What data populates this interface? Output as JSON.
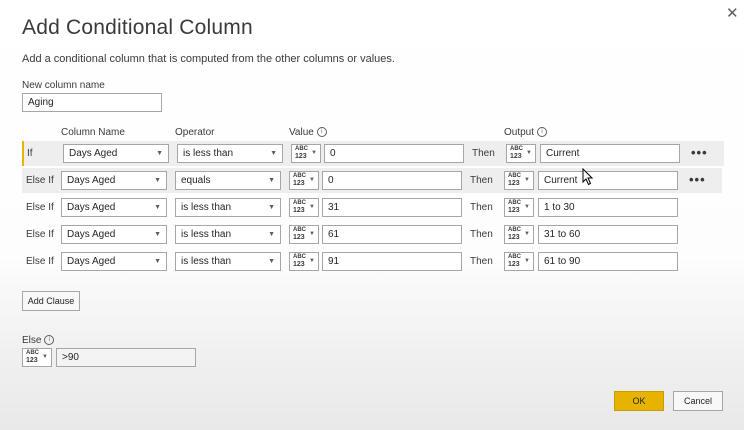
{
  "dialog": {
    "title": "Add Conditional Column",
    "description": "Add a conditional column that is computed from the other columns or values.",
    "close_glyph": "✕"
  },
  "new_column": {
    "label": "New column name",
    "value": "Aging"
  },
  "headers": {
    "column_name": "Column Name",
    "operator": "Operator",
    "value": "Value",
    "output": "Output"
  },
  "type_icon": {
    "top": "ABC",
    "bottom": "123",
    "name": "any-type-icon"
  },
  "clauses": [
    {
      "keyword": "If",
      "column": "Days Aged",
      "operator": "is less than",
      "value": "0",
      "then": "Then",
      "output": "Current",
      "more": "•••"
    },
    {
      "keyword": "Else If",
      "column": "Days Aged",
      "operator": "equals",
      "value": "0",
      "then": "Then",
      "output": "Current",
      "more": "•••"
    },
    {
      "keyword": "Else If",
      "column": "Days Aged",
      "operator": "is less than",
      "value": "31",
      "then": "Then",
      "output": "1 to 30"
    },
    {
      "keyword": "Else If",
      "column": "Days Aged",
      "operator": "is less than",
      "value": "61",
      "then": "Then",
      "output": "31 to 60"
    },
    {
      "keyword": "Else If",
      "column": "Days Aged",
      "operator": "is less than",
      "value": "91",
      "then": "Then",
      "output": "61 to 90"
    }
  ],
  "add_clause_label": "Add Clause",
  "else": {
    "label": "Else",
    "value": ">90"
  },
  "buttons": {
    "ok": "OK",
    "cancel": "Cancel"
  },
  "colors": {
    "accent": "#e6b400",
    "row_highlight": "#eeeeee"
  }
}
